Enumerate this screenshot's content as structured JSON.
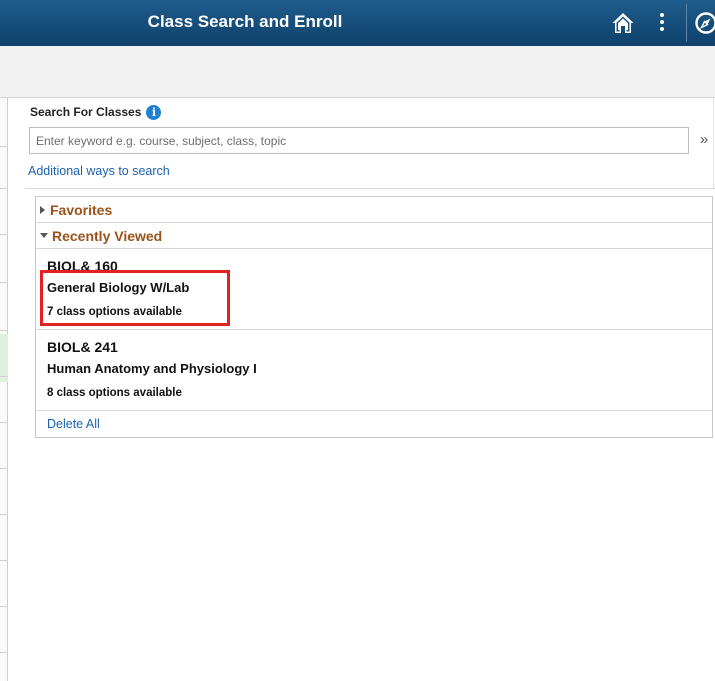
{
  "header": {
    "title": "Class Search and Enroll",
    "home_icon": "home-icon",
    "actions_icon": "kebab-menu-icon",
    "navbar_icon": "compass-icon"
  },
  "search": {
    "label": "Search For Classes",
    "info_icon": "info-icon",
    "placeholder": "Enter keyword e.g. course, subject, class, topic",
    "value": "",
    "go_glyph": "»",
    "more_link": "Additional ways to search"
  },
  "favorites": {
    "label": "Favorites",
    "expanded": false
  },
  "recent": {
    "label": "Recently Viewed",
    "expanded": true,
    "items": [
      {
        "code": "BIOL& 160",
        "title": "General Biology W/Lab",
        "availability": "7 class options available",
        "highlighted": true
      },
      {
        "code": "BIOL& 241",
        "title": "Human Anatomy and Physiology I",
        "availability": "8 class options available",
        "highlighted": false
      }
    ],
    "delete_all": "Delete All"
  },
  "colors": {
    "header_bg": "#1a5283",
    "group_heading": "#9b531b",
    "link": "#1a62b3",
    "highlight": "#e02222",
    "info": "#1f7fd1"
  }
}
